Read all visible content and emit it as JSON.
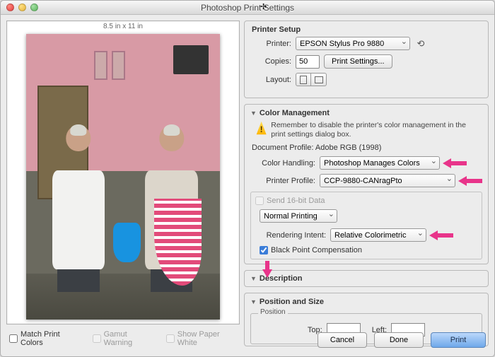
{
  "window": {
    "title": "Photoshop Print Settings"
  },
  "preview": {
    "size_label": "8.5 in x 11 in"
  },
  "left_footer": {
    "match_colors": "Match Print Colors",
    "gamut_warning": "Gamut Warning",
    "show_paper_white": "Show Paper White"
  },
  "printer_setup": {
    "header": "Printer Setup",
    "printer_label": "Printer:",
    "printer_value": "EPSON Stylus Pro 9880",
    "copies_label": "Copies:",
    "copies_value": "50",
    "print_settings_btn": "Print Settings...",
    "layout_label": "Layout:"
  },
  "color_mgmt": {
    "header": "Color Management",
    "warning": "Remember to disable the printer's color management in the print settings dialog box.",
    "doc_profile": "Document Profile: Adobe RGB (1998)",
    "handling_label": "Color Handling:",
    "handling_value": "Photoshop Manages Colors",
    "profile_label": "Printer Profile:",
    "profile_value": "CCP-9880-CANragPto",
    "send16_label": "Send 16-bit Data",
    "normal_printing": "Normal Printing",
    "ri_label": "Rendering Intent:",
    "ri_value": "Relative Colorimetric",
    "bpc_label": "Black Point Compensation"
  },
  "description": {
    "header": "Description"
  },
  "position": {
    "header": "Position and Size",
    "fieldset": "Position",
    "top_label": "Top:",
    "left_label": "Left:"
  },
  "footer": {
    "cancel": "Cancel",
    "done": "Done",
    "print": "Print"
  }
}
